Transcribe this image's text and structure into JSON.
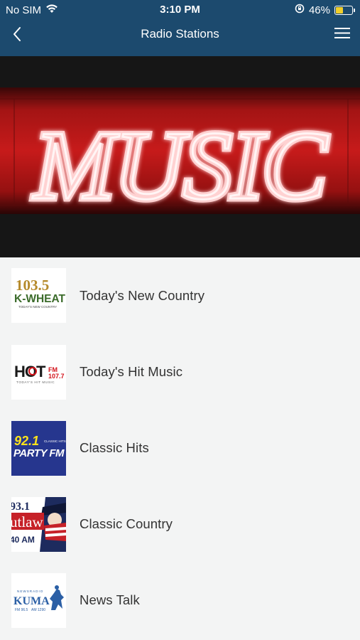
{
  "status_bar": {
    "carrier": "No SIM",
    "time": "3:10 PM",
    "battery_percent": "46%",
    "battery_level": 0.46,
    "battery_color": "#f1cf2b"
  },
  "nav": {
    "title": "Radio Stations",
    "back_icon": "chevron-left-icon",
    "menu_icon": "hamburger-menu-icon",
    "bar_color": "#1c4a6e"
  },
  "hero": {
    "image_text": "MUSIC",
    "neon_color": "#e61e1e"
  },
  "stations": [
    {
      "label": "Today's New Country",
      "logo_lines": [
        "103.5",
        "K-WHEAT",
        "TODAY'S NEW COUNTRY"
      ]
    },
    {
      "label": "Today's Hit Music",
      "logo_lines": [
        "HOT",
        "FM",
        "107.7",
        "TODAY'S HIT MUSIC"
      ]
    },
    {
      "label": "Classic Hits",
      "logo_lines": [
        "92.1",
        "PARTY FM",
        "CLASSIC HITS"
      ]
    },
    {
      "label": "Classic Country",
      "logo_lines": [
        "93.1",
        "utlaw",
        "40 AM"
      ]
    },
    {
      "label": "News Talk",
      "logo_lines": [
        "NEWSRADIO",
        "KUMA",
        "FM 96.5",
        "AM 1290"
      ]
    }
  ]
}
